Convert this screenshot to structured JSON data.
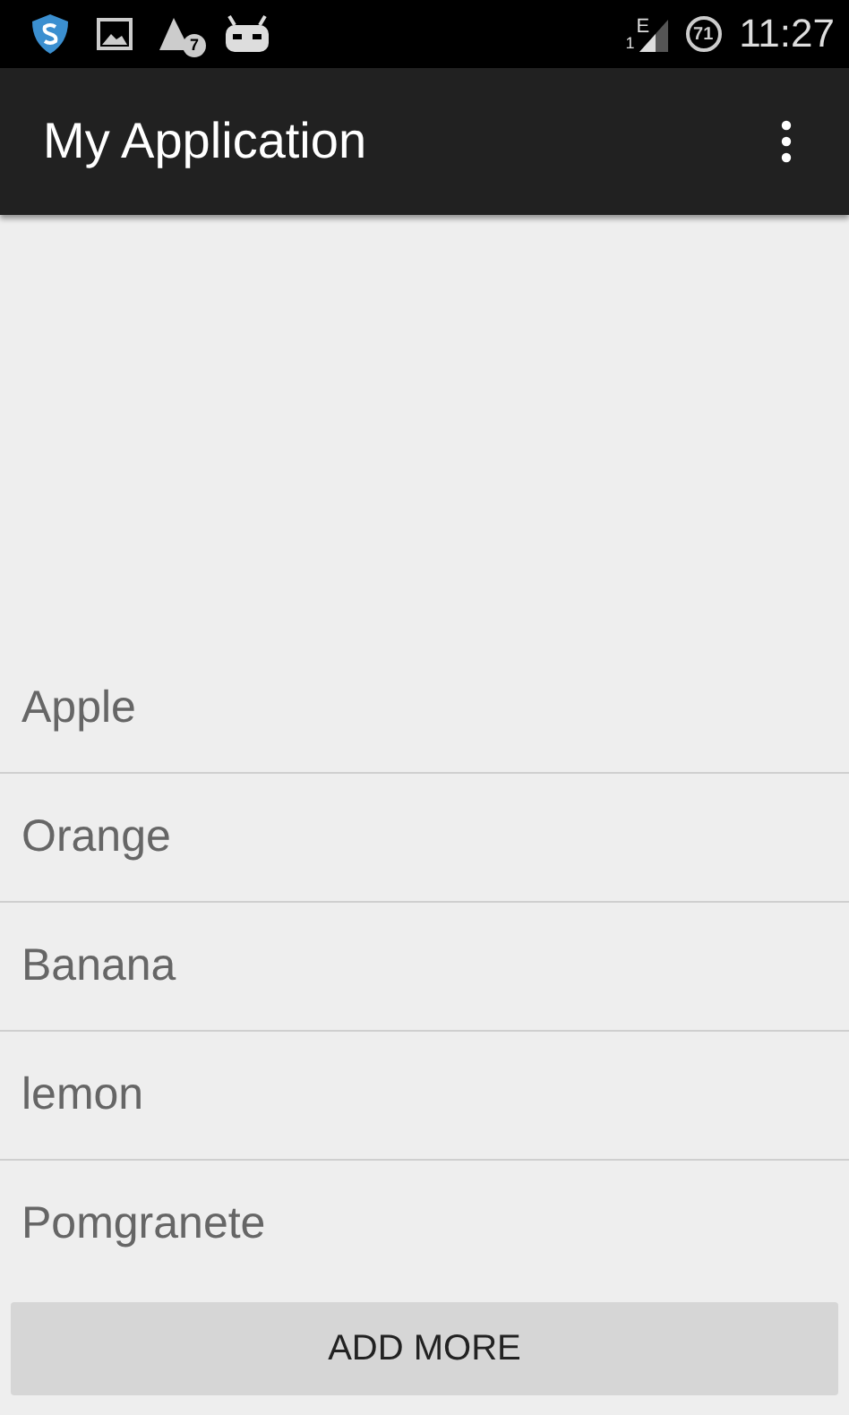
{
  "status_bar": {
    "notification_badge": "7",
    "sim_slot": "1",
    "network_type": "E",
    "battery_percent": "71",
    "time": "11:27"
  },
  "app_bar": {
    "title": "My Application"
  },
  "list": {
    "items": [
      {
        "label": "Apple"
      },
      {
        "label": "Orange"
      },
      {
        "label": "Banana"
      },
      {
        "label": "lemon"
      },
      {
        "label": "Pomgranete"
      }
    ]
  },
  "button": {
    "label": "ADD MORE"
  }
}
